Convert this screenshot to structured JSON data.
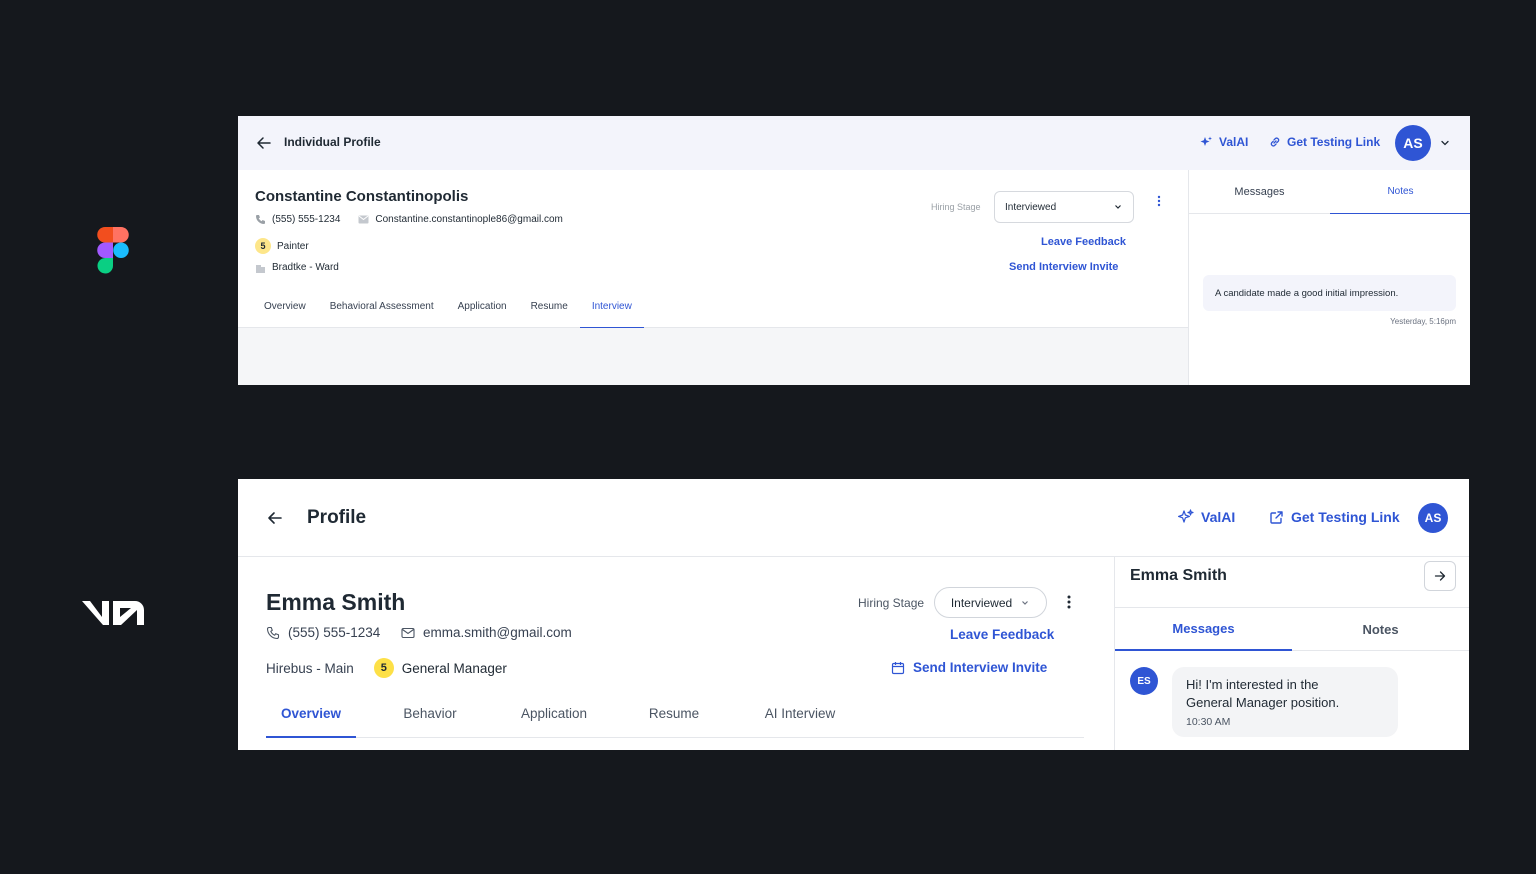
{
  "frame1": {
    "page_title": "Individual Profile",
    "valai": "ValAI",
    "get_testing_link": "Get Testing Link",
    "avatar_initials": "AS",
    "candidate": {
      "name": "Constantine Constantinopolis",
      "phone": "(555) 555-1234",
      "email": "Constantine.constantinople86@gmail.com",
      "score": "5",
      "role": "Painter",
      "location": "Bradtke - Ward"
    },
    "hiring_stage_label": "Hiring Stage",
    "hiring_stage_value": "Interviewed",
    "leave_feedback": "Leave Feedback",
    "send_interview_invite": "Send Interview Invite",
    "tabs": [
      "Overview",
      "Behavioral Assessment",
      "Application",
      "Resume",
      "Interview"
    ],
    "active_tab": "Interview",
    "side_tabs": [
      "Messages",
      "Notes"
    ],
    "note_text": "A candidate made a good initial impression.",
    "note_time": "Yesterday, 5:16pm"
  },
  "frame2": {
    "page_title": "Profile",
    "valai": "ValAI",
    "get_testing_link": "Get Testing Link",
    "avatar_initials": "AS",
    "candidate": {
      "name": "Emma Smith",
      "phone": "(555) 555-1234",
      "email": "emma.smith@gmail.com",
      "location": "Hirebus - Main",
      "score": "5",
      "role": "General Manager"
    },
    "hiring_stage_label": "Hiring Stage",
    "hiring_stage_value": "Interviewed",
    "leave_feedback": "Leave Feedback",
    "send_interview_invite": "Send Interview Invite",
    "tabs": [
      "Overview",
      "Behavior",
      "Application",
      "Resume",
      "AI Interview"
    ],
    "active_tab": "Overview",
    "side_name": "Emma Smith",
    "side_tabs": [
      "Messages",
      "Notes"
    ],
    "message": {
      "initials": "ES",
      "line1": "Hi! I'm interested in the",
      "line2": "General Manager position.",
      "time": "10:30 AM"
    }
  },
  "colors": {
    "accent": "#2f55d4",
    "background": "#15181d",
    "score_badge": "#fde047"
  }
}
